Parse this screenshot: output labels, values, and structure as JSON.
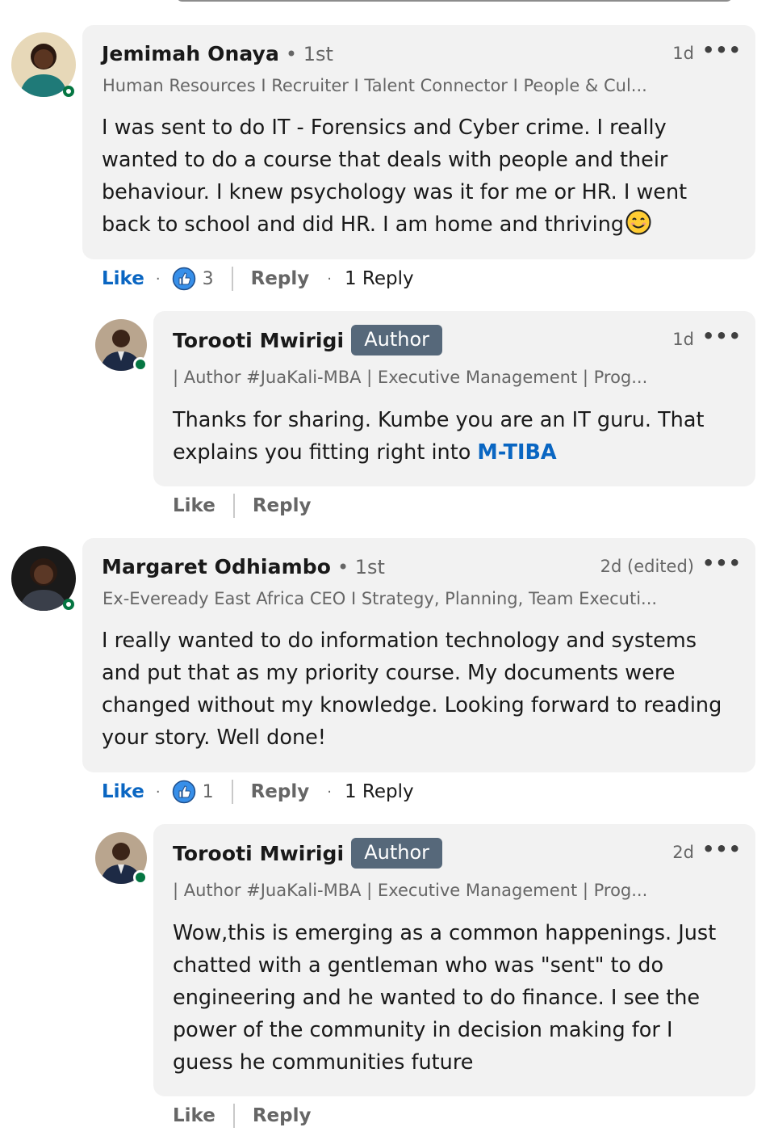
{
  "comments": [
    {
      "name": "Jemimah Onaya",
      "degree": "• 1st",
      "headline": "Human Resources I Recruiter I Talent Connector I People & Cul...",
      "time": "1d",
      "more": "•••",
      "body": "I was sent to do IT - Forensics and Cyber crime. I really wanted to do a course that deals with people and their behaviour. I knew psychology was it for me or HR. I went back to school and did HR. I am home and thriving",
      "emoji": "smiling-face",
      "like": "Like",
      "reaction_count": "3",
      "reply": "Reply",
      "replies": "1 Reply",
      "reply_comment": {
        "name": "Torooti Mwirigi",
        "badge": "Author",
        "headline": "| Author #JuaKali-MBA | Executive Management | Prog...",
        "time": "1d",
        "more": "•••",
        "body_text": "Thanks for sharing. Kumbe you are an IT guru. That explains you fitting right into ",
        "mention": "M-TIBA",
        "like": "Like",
        "reply": "Reply"
      }
    },
    {
      "name": "Margaret Odhiambo",
      "degree": "• 1st",
      "headline": "Ex-Eveready East Africa CEO I Strategy, Planning, Team Executi...",
      "time": "2d (edited)",
      "more": "•••",
      "body": "I really wanted to do information technology and systems and put that as my priority course. My documents were changed without my knowledge. Looking forward to reading your story. Well done!",
      "like": "Like",
      "reaction_count": "1",
      "reply": "Reply",
      "replies": "1 Reply",
      "reply_comment": {
        "name": "Torooti Mwirigi",
        "badge": "Author",
        "headline": "| Author #JuaKali-MBA | Executive Management | Prog...",
        "time": "2d",
        "more": "•••",
        "body": "Wow,this is emerging as a common happenings. Just chatted with a gentleman who was \"sent\" to do engineering and he wanted to do finance. I see the power of the community in decision making for I guess he communities future",
        "like": "Like",
        "reply": "Reply"
      }
    }
  ],
  "colors": {
    "link": "#0a66c2",
    "presence": "#057642",
    "badge": "#56687a",
    "bubble": "#f2f2f2"
  }
}
